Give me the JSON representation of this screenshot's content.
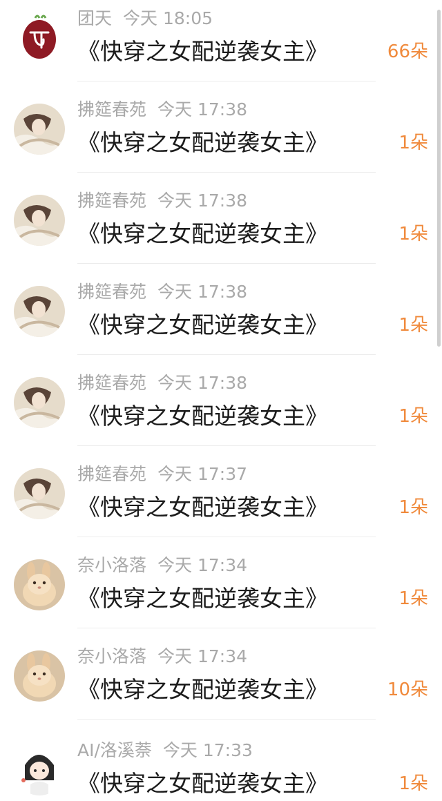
{
  "colors": {
    "amount": "#f08a3c",
    "username": "#a9a9a9",
    "title": "#1c1c1c",
    "divider": "#ececec"
  },
  "records": [
    {
      "user": "团天",
      "time": "今天 18:05",
      "title": "《快穿之女配逆袭女主》",
      "amount": "66朵",
      "avatar": "red-logo-avatar"
    },
    {
      "user": "拂筵春苑",
      "time": "今天 17:38",
      "title": "《快穿之女配逆袭女主》",
      "amount": "1朵",
      "avatar": "illustrated-character-avatar"
    },
    {
      "user": "拂筵春苑",
      "time": "今天 17:38",
      "title": "《快穿之女配逆袭女主》",
      "amount": "1朵",
      "avatar": "illustrated-character-avatar"
    },
    {
      "user": "拂筵春苑",
      "time": "今天 17:38",
      "title": "《快穿之女配逆袭女主》",
      "amount": "1朵",
      "avatar": "illustrated-character-avatar"
    },
    {
      "user": "拂筵春苑",
      "time": "今天 17:38",
      "title": "《快穿之女配逆袭女主》",
      "amount": "1朵",
      "avatar": "illustrated-character-avatar"
    },
    {
      "user": "拂筵春苑",
      "time": "今天 17:37",
      "title": "《快穿之女配逆袭女主》",
      "amount": "1朵",
      "avatar": "illustrated-character-avatar"
    },
    {
      "user": "奈小洛落",
      "time": "今天 17:34",
      "title": "《快穿之女配逆袭女主》",
      "amount": "1朵",
      "avatar": "rabbit-photo-avatar"
    },
    {
      "user": "奈小洛落",
      "time": "今天 17:34",
      "title": "《快穿之女配逆袭女主》",
      "amount": "10朵",
      "avatar": "rabbit-photo-avatar"
    },
    {
      "user": "AI/洛溪萘",
      "time": "今天 17:33",
      "title": "《快穿之女配逆袭女主》",
      "amount": "1朵",
      "avatar": "chibi-character-avatar"
    }
  ]
}
